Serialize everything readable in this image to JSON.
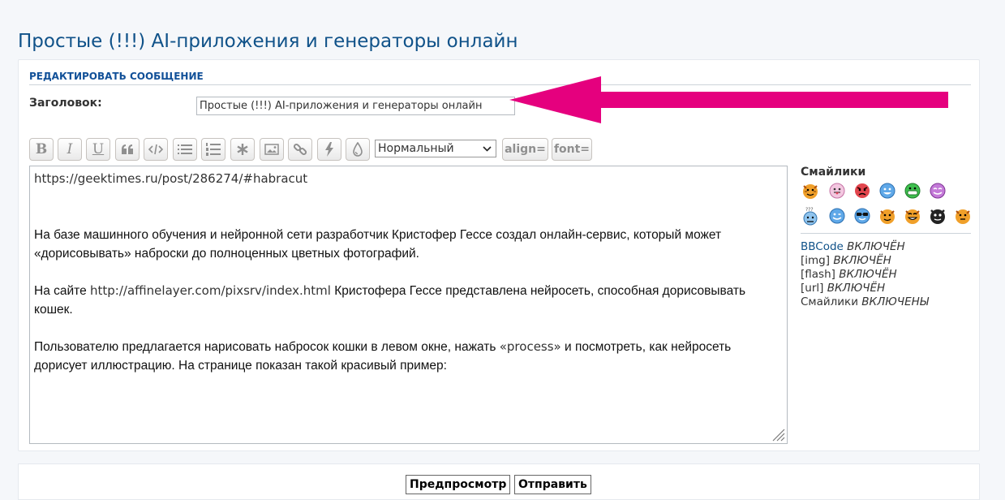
{
  "page": {
    "title": "Простые (!!!) AI-приложения и генераторы онлайн"
  },
  "panel": {
    "section_title": "РЕДАКТИРОВАТЬ СООБЩЕНИЕ",
    "subject_label": "Заголовок:",
    "subject_value": "Простые (!!!) AI-приложения и генераторы онлайн"
  },
  "annotation": {
    "arrow_color": "#e5007e"
  },
  "toolbar": {
    "buttons": [
      "bold-icon",
      "italic-icon",
      "underline-icon",
      "quote-icon",
      "code-icon",
      "list-icon",
      "ordered-list-icon",
      "list-item-icon",
      "image-icon",
      "link-icon",
      "flash-icon",
      "color-icon"
    ],
    "bold": "B",
    "italic": "I",
    "underline": "U",
    "font_size_selected": "Нормальный",
    "align_label": "align=",
    "font_label": "font="
  },
  "message": {
    "line1": "https://geektimes.ru/post/286274/#habracut",
    "p1": "На базе машинного обучения и нейронной сети разработчик Кристофер Гессе создал онлайн-сервис, который может «дорисовывать» наброски до полноценных цветных фотографий.",
    "p2_a": "На сайте ",
    "p2_link": "http://affinelayer.com/pixsrv/index.html",
    "p2_b": " Кристофера Гессе представлена нейросеть, способная дорисовывать кошек.",
    "p3_a": "Пользователю предлагается нарисовать набросок кошки в левом окне, нажать ",
    "p3_b": "«process»",
    "p3_c": " и посмотреть, как нейросеть дорисует иллюстрацию. На странице показан такой красивый пример:"
  },
  "smilies": {
    "title": "Смайлики",
    "items": [
      "tiger-smiley-icon",
      "tongue-smiley-icon",
      "angry-smiley-icon",
      "happy-smiley-icon",
      "grin-smiley-icon",
      "purple-smiley-icon",
      "confused-smiley-icon",
      "wink-smiley-icon",
      "cool-smiley-icon",
      "tiger-smiley-icon",
      "tiger-laugh-smiley-icon",
      "black-cat-smiley-icon",
      "tiger-smiley-icon"
    ]
  },
  "status": {
    "bbcode": "BBCode",
    "bbcode_state": "ВКЛЮЧЁН",
    "img": "[img]",
    "img_state": "ВКЛЮЧЁН",
    "flash": "[flash]",
    "flash_state": "ВКЛЮЧЁН",
    "url": "[url]",
    "url_state": "ВКЛЮЧЁН",
    "smilies": "Смайлики",
    "smilies_state": "ВКЛЮЧЕНЫ"
  },
  "actions": {
    "preview": "Предпросмотр",
    "submit": "Отправить"
  }
}
